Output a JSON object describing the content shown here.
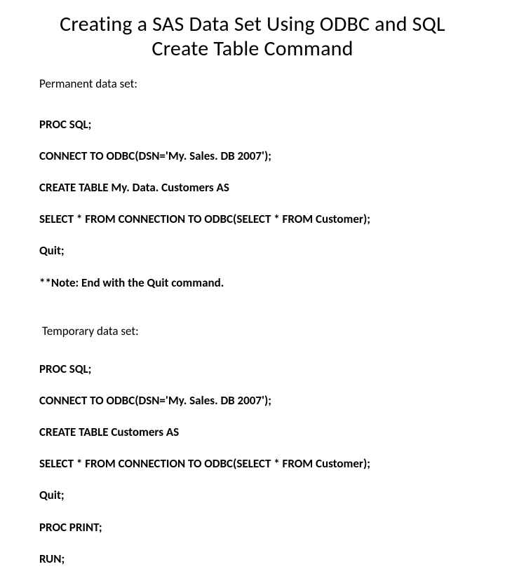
{
  "title": "Creating a SAS Data Set Using ODBC and SQL Create Table Command",
  "section1": {
    "label": "Permanent data set:",
    "lines": [
      "PROC SQL;",
      "CONNECT TO ODBC(DSN='My. Sales. DB 2007');",
      "CREATE TABLE My. Data. Customers AS",
      "SELECT * FROM CONNECTION TO ODBC(SELECT * FROM Customer);",
      "Quit;",
      "**Note: End with the Quit command."
    ]
  },
  "section2": {
    "label": "Temporary data set:",
    "lines": [
      "PROC SQL;",
      "CONNECT TO ODBC(DSN='My. Sales. DB 2007');",
      "CREATE TABLE Customers AS",
      "SELECT * FROM CONNECTION TO ODBC(SELECT * FROM Customer);",
      "Quit;",
      "PROC PRINT;",
      "RUN;"
    ]
  }
}
